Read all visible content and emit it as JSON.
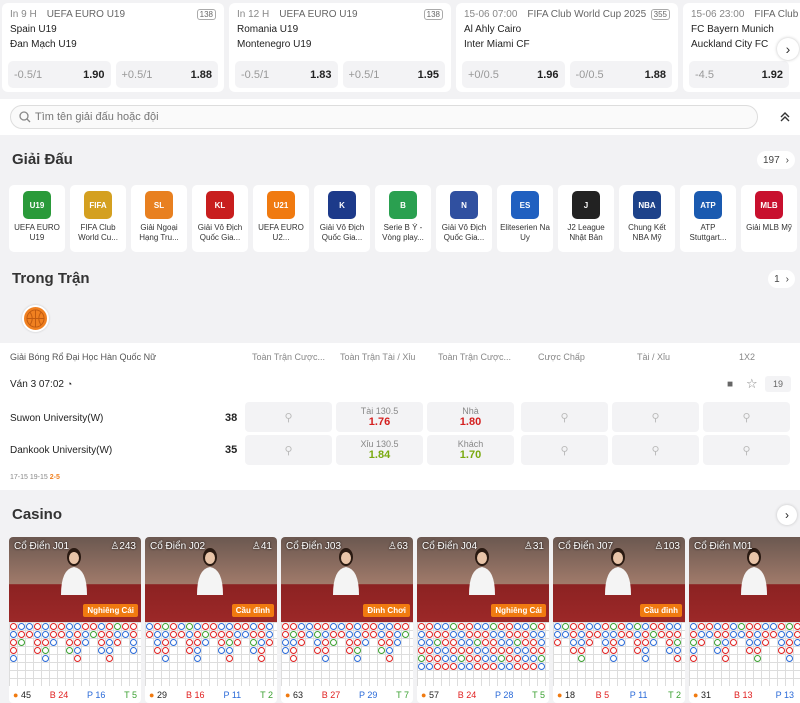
{
  "matches": [
    {
      "time": "In 9 H",
      "league": "UEFA EURO U19",
      "count": "138",
      "home": "Spain U19",
      "away": "Đan Mạch U19",
      "odds": [
        {
          "h": "-0.5/1",
          "v": "1.90"
        },
        {
          "h": "+0.5/1",
          "v": "1.88"
        }
      ]
    },
    {
      "time": "In 12 H",
      "league": "UEFA EURO U19",
      "count": "138",
      "home": "Romania U19",
      "away": "Montenegro U19",
      "odds": [
        {
          "h": "-0.5/1",
          "v": "1.83"
        },
        {
          "h": "+0.5/1",
          "v": "1.95"
        }
      ]
    },
    {
      "time": "15-06 07:00",
      "league": "FIFA Club World Cup 2025 (tại...",
      "count": "355",
      "home": "Al Ahly Cairo",
      "away": "Inter Miami CF",
      "odds": [
        {
          "h": "+0/0.5",
          "v": "1.96"
        },
        {
          "h": "-0/0.5",
          "v": "1.88"
        }
      ]
    },
    {
      "time": "15-06 23:00",
      "league": "FIFA Club",
      "count": "",
      "home": "FC Bayern Munich",
      "away": "Auckland City FC",
      "odds": [
        {
          "h": "-4.5",
          "v": "1.92"
        },
        {
          "h": "",
          "v": ""
        }
      ]
    }
  ],
  "search": {
    "placeholder": "Tìm tên giải đấu hoặc đội"
  },
  "leagues_section": {
    "title": "Giải Đấu",
    "count": "197"
  },
  "leagues": [
    {
      "name": "UEFA EURO U19",
      "color": "#2a9a3a",
      "abbr": "U19"
    },
    {
      "name": "FIFA Club World Cu...",
      "color": "#d4a020",
      "abbr": "FIFA"
    },
    {
      "name": "Giải Ngoại Hạng Tru...",
      "color": "#e88020",
      "abbr": "SL"
    },
    {
      "name": "Giải Vô Địch Quốc Gia...",
      "color": "#c81e1e",
      "abbr": "KL"
    },
    {
      "name": "UEFA EURO U2...",
      "color": "#f07a10",
      "abbr": "U21"
    },
    {
      "name": "Giải Vô Địch Quốc Gia...",
      "color": "#1d3a8a",
      "abbr": "K"
    },
    {
      "name": "Serie B Ý - Vòng play...",
      "color": "#2aa050",
      "abbr": "B"
    },
    {
      "name": "Giải Vô Địch Quốc Gia...",
      "color": "#3050a0",
      "abbr": "N"
    },
    {
      "name": "Eliteserien Na Uy",
      "color": "#2060c0",
      "abbr": "ES"
    },
    {
      "name": "J2 League Nhật Bản",
      "color": "#222222",
      "abbr": "J"
    },
    {
      "name": "Chung Kết NBA Mỹ",
      "color": "#1d428a",
      "abbr": "NBA"
    },
    {
      "name": "ATP Stuttgart...",
      "color": "#1a5ab0",
      "abbr": "ATP"
    },
    {
      "name": "Giải MLB Mỹ",
      "color": "#c8102e",
      "abbr": "MLB"
    }
  ],
  "inplay_section": {
    "title": "Trong Trận",
    "count": "1"
  },
  "live": {
    "league": "Giải Bóng Rổ Đại Học Hàn Quốc Nữ",
    "headers": [
      "Toàn Trận Cược...",
      "Toàn Trận Tài / Xỉu",
      "Toàn Trận Cược...",
      "Cược Chấp",
      "Tài / Xỉu",
      "1X2"
    ],
    "period": "Ván 3 07:02",
    "markets": "19",
    "home": {
      "name": "Suwon University(W)",
      "score": "38"
    },
    "away": {
      "name": "Dankook University(W)",
      "score": "35"
    },
    "ou": {
      "over_label": "Tài 130.5",
      "over_val": "1.76",
      "under_label": "Xỉu 130.5",
      "under_val": "1.84"
    },
    "ml": {
      "home_label": "Nhà",
      "home_val": "1.80",
      "away_label": "Khách",
      "away_val": "1.70"
    },
    "quarters": "17-15  19-15",
    "current_q": "2-5"
  },
  "casino_section": {
    "title": "Casino"
  },
  "casino_tables": [
    {
      "name": "Cổ Điển J01",
      "players": "243",
      "tag": "Nghiêng Cái",
      "total": "45",
      "b": "24",
      "p": "16",
      "t": "5"
    },
    {
      "name": "Cổ Điển J02",
      "players": "41",
      "tag": "Cầu đỉnh",
      "total": "29",
      "b": "16",
      "p": "11",
      "t": "2"
    },
    {
      "name": "Cổ Điển J03",
      "players": "63",
      "tag": "Đỉnh Chơi",
      "total": "63",
      "b": "27",
      "p": "29",
      "t": "7"
    },
    {
      "name": "Cổ Điển J04",
      "players": "31",
      "tag": "Nghiêng Cái",
      "total": "57",
      "b": "24",
      "p": "28",
      "t": "5"
    },
    {
      "name": "Cổ Điển J07",
      "players": "103",
      "tag": "Cầu đỉnh",
      "total": "18",
      "b": "5",
      "p": "11",
      "t": "2"
    },
    {
      "name": "Cổ Điển M01",
      "players": "",
      "tag": "",
      "total": "31",
      "b": "13",
      "p": "13",
      "t": ""
    }
  ],
  "colors": {
    "accent": "#f07a10",
    "banker": "#e02020",
    "player": "#2a6ad8",
    "tie": "#3aa030",
    "odd_red": "#d42020",
    "odd_green": "#7aaa10"
  }
}
